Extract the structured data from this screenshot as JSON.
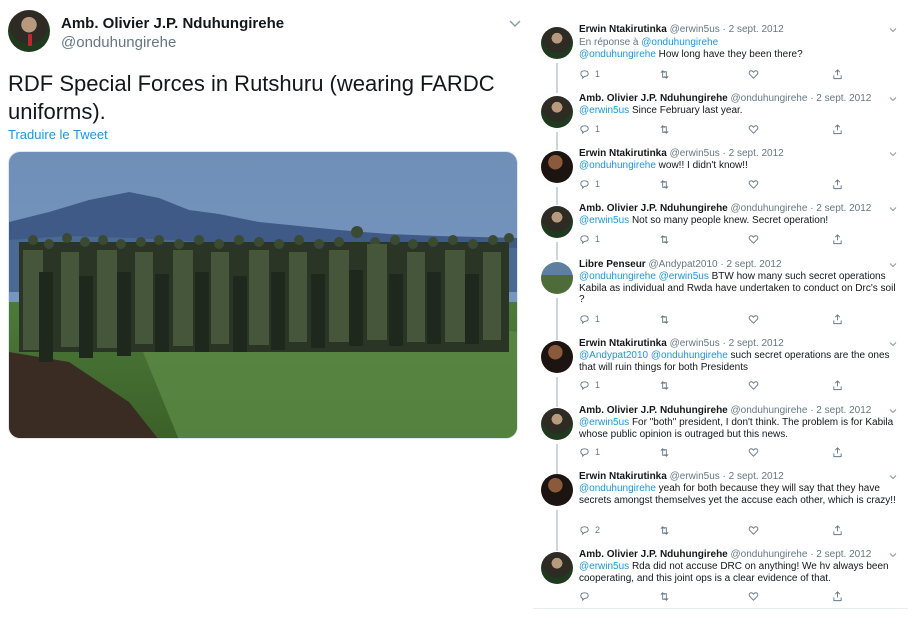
{
  "main_tweet": {
    "author_name": "Amb. Olivier J.P. Nduhungirehe",
    "author_handle": "@onduhungirehe",
    "text": "RDF Special Forces in Rutshuru (wearing FARDC uniforms).",
    "translate_label": "Traduire le Tweet",
    "photo_icon": "soldiers-photo"
  },
  "replies": [
    {
      "name": "Erwin Ntakirutinka",
      "meta": "@erwin5us · 2 sept. 2012",
      "context_prefix": "En réponse à ",
      "context_handle": "@onduhungirehe",
      "mention": "@onduhungirehe",
      "text": " How long have they been there?",
      "reply_count": "1",
      "avatar": "avatar-erwin"
    },
    {
      "name": "Amb. Olivier J.P. Nduhungirehe",
      "meta": "@onduhungirehe · 2 sept. 2012",
      "mention": "@erwin5us",
      "text": " Since February last year.",
      "reply_count": "1",
      "avatar": "avatar-olivier"
    },
    {
      "name": "Erwin Ntakirutinka",
      "meta": "@erwin5us · 2 sept. 2012",
      "mention": "@onduhungirehe",
      "text": " wow!! I didn't know!!",
      "reply_count": "1",
      "avatar": "avatar-erwin"
    },
    {
      "name": "Amb. Olivier J.P. Nduhungirehe",
      "meta": "@onduhungirehe · 2 sept. 2012",
      "mention": "@erwin5us",
      "text": " Not so many people knew. Secret operation!",
      "reply_count": "1",
      "avatar": "avatar-olivier"
    },
    {
      "name": "Libre Penseur",
      "meta": "@Andypat2010 · 2 sept. 2012",
      "mention": "@onduhungirehe @erwin5us",
      "text": " BTW how many such secret operations Kabila as individual and Rwda have undertaken to conduct on Drc's soil ?",
      "reply_count": "1",
      "avatar": "avatar-libre-penseur"
    },
    {
      "name": "Erwin Ntakirutinka",
      "meta": "@erwin5us · 2 sept. 2012",
      "mention": "@Andypat2010 @onduhungirehe",
      "text": " such secret operations are the ones that will ruin things for both Presidents",
      "reply_count": "1",
      "avatar": "avatar-erwin"
    },
    {
      "name": "Amb. Olivier J.P. Nduhungirehe",
      "meta": "@onduhungirehe · 2 sept. 2012",
      "mention": "@erwin5us",
      "text": " For \"both\" president, I don't think. The problem is for Kabila whose public opinion is outraged but this news.",
      "reply_count": "1",
      "avatar": "avatar-olivier"
    },
    {
      "name": "Erwin Ntakirutinka",
      "meta": "@erwin5us · 2 sept. 2012",
      "mention": "@onduhungirehe",
      "text": " yeah for both because they will say that they have secrets amongst themselves yet the accuse each other, which is crazy!!",
      "reply_count": "2",
      "avatar": "avatar-erwin"
    },
    {
      "name": "Amb. Olivier J.P. Nduhungirehe",
      "meta": "@onduhungirehe · 2 sept. 2012",
      "mention": "@erwin5us",
      "text": " Rda did not accuse DRC on anything! We hv always been cooperating, and this joint ops is a clear evidence of that.",
      "reply_count": "",
      "avatar": "avatar-olivier"
    }
  ],
  "colors": {
    "link": "#1b95e0",
    "text": "#14171a",
    "secondary": "#657786",
    "thread_line": "#ccd6dd"
  }
}
